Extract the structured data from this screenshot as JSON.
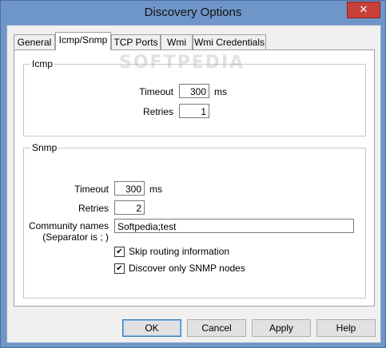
{
  "window": {
    "title": "Discovery Options",
    "close_glyph": "✕"
  },
  "tabs": [
    {
      "label": "General",
      "active": false
    },
    {
      "label": "Icmp/Snmp",
      "active": true
    },
    {
      "label": "TCP Ports",
      "active": false
    },
    {
      "label": "Wmi",
      "active": false
    },
    {
      "label": "Wmi Credentials",
      "active": false
    }
  ],
  "watermark": "SOFTPEDIA",
  "icmp": {
    "caption": "Icmp",
    "timeout_label": "Timeout",
    "timeout_value": "300",
    "timeout_unit": "ms",
    "retries_label": "Retries",
    "retries_value": "1"
  },
  "snmp": {
    "caption": "Snmp",
    "timeout_label": "Timeout",
    "timeout_value": "300",
    "timeout_unit": "ms",
    "retries_label": "Retries",
    "retries_value": "2",
    "community_label": "Community names",
    "community_sublabel": "(Separator is ; )",
    "community_value": "Softpedia;test",
    "skip_routing_label": "Skip routing information",
    "skip_routing_checked": true,
    "discover_snmp_label": "Discover only SNMP nodes",
    "discover_snmp_checked": true,
    "check_glyph": "✔"
  },
  "buttons": {
    "ok": "OK",
    "cancel": "Cancel",
    "apply": "Apply",
    "help": "Help"
  }
}
